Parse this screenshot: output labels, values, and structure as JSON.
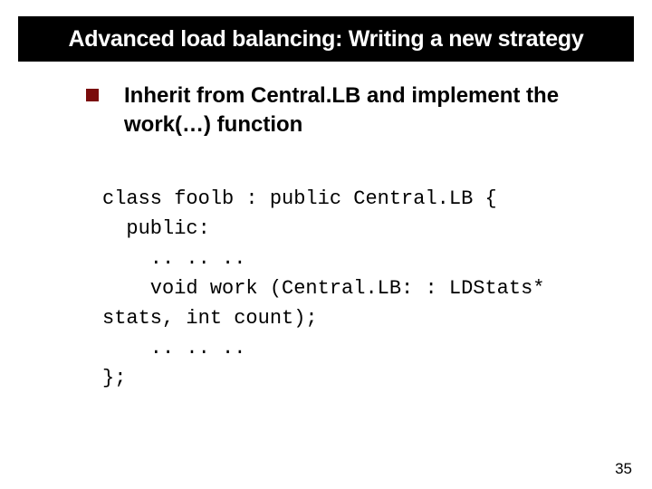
{
  "slide": {
    "title": "Advanced load balancing: Writing a new strategy",
    "bullet": "Inherit from Central.LB and implement the work(…) function",
    "code": {
      "l1": "class foolb : public Central.LB {",
      "l2": "  public:",
      "l3": "    .. .. ..",
      "l4": "    void work (Central.LB: : LDStats*",
      "l5": "stats, int count);",
      "l6": "    .. .. ..",
      "l7": "};"
    },
    "page_number": "35"
  }
}
